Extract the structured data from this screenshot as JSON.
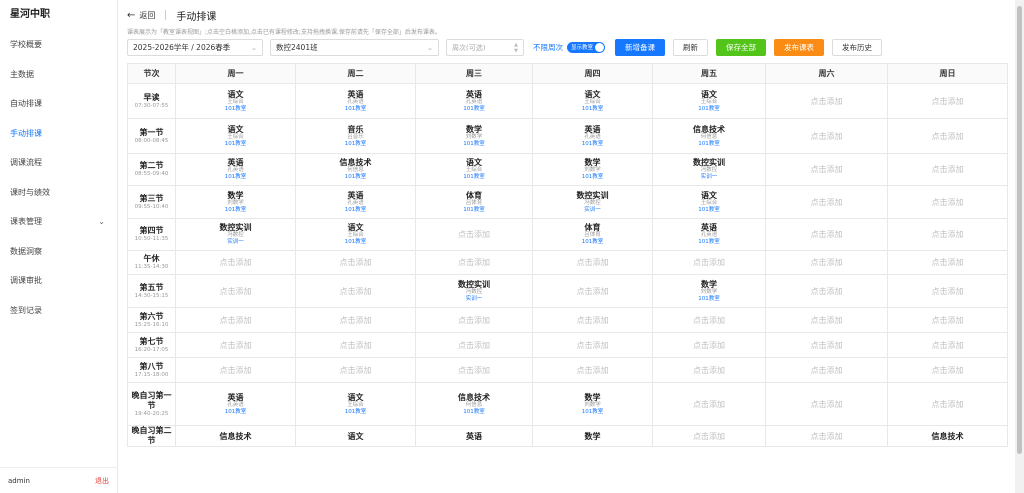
{
  "app": {
    "name": "星河中职"
  },
  "sidebar": {
    "items": [
      {
        "label": "学校概要",
        "active": false,
        "chevron": false
      },
      {
        "label": "主数据",
        "active": false,
        "chevron": false
      },
      {
        "label": "自动排课",
        "active": false,
        "chevron": false
      },
      {
        "label": "手动排课",
        "active": true,
        "chevron": false
      },
      {
        "label": "调课流程",
        "active": false,
        "chevron": false
      },
      {
        "label": "课时与绩效",
        "active": false,
        "chevron": false
      },
      {
        "label": "课表管理",
        "active": false,
        "chevron": true
      },
      {
        "label": "数据洞察",
        "active": false,
        "chevron": false
      },
      {
        "label": "调课审批",
        "active": false,
        "chevron": false
      },
      {
        "label": "签到记录",
        "active": false,
        "chevron": false
      }
    ],
    "user": "admin",
    "logout": "退出"
  },
  "header": {
    "back": "返回",
    "title": "手动排课",
    "hint": "课表展示为「教室课表视图」;点击空白格添加,点击已有课程修改;支持拖拽换课,保存前请先「保存全部」后发布课表。"
  },
  "filters": {
    "semester": "2025-2026学年 / 2026春季",
    "class": "数控2401班",
    "week_placeholder": "周次(可选)",
    "unlimited": "不限周次",
    "toggle": "显示教室"
  },
  "buttons": {
    "add_note": "新增备课",
    "refresh": "刷新",
    "save_all": "保存全部",
    "publish": "发布课表",
    "history": "发布历史"
  },
  "colors": {
    "primary": "#1677ff",
    "success": "#52c41a",
    "warning": "#fa8c16",
    "danger": "#e53935"
  },
  "empty_label": "点击添加",
  "timetable": {
    "columns": [
      "节次",
      "周一",
      "周二",
      "周三",
      "周四",
      "周五",
      "周六",
      "周日"
    ],
    "rows": [
      {
        "name": "早读",
        "time": "07:30-07:55",
        "cells": [
          {
            "subject": "语文",
            "teacher": "王综合",
            "room": "101教室"
          },
          {
            "subject": "英语",
            "teacher": "孔英语",
            "room": "101教室"
          },
          {
            "subject": "英语",
            "teacher": "孔英语",
            "room": "101教室"
          },
          {
            "subject": "语文",
            "teacher": "王综合",
            "room": "101教室"
          },
          {
            "subject": "语文",
            "teacher": "王综合",
            "room": "101教室"
          },
          null,
          null
        ]
      },
      {
        "name": "第一节",
        "time": "08:00-08:45",
        "cells": [
          {
            "subject": "语文",
            "teacher": "王综合",
            "room": "101教室"
          },
          {
            "subject": "音乐",
            "teacher": "吕音乐",
            "room": "101教室"
          },
          {
            "subject": "数学",
            "teacher": "刘数学",
            "room": "101教室"
          },
          {
            "subject": "英语",
            "teacher": "孔英语",
            "room": "101教室"
          },
          {
            "subject": "信息技术",
            "teacher": "何信息",
            "room": "101教室"
          },
          null,
          null
        ]
      },
      {
        "name": "第二节",
        "time": "08:55-09:40",
        "cells": [
          {
            "subject": "英语",
            "teacher": "孔英语",
            "room": "101教室"
          },
          {
            "subject": "信息技术",
            "teacher": "何信息",
            "room": "101教室"
          },
          {
            "subject": "语文",
            "teacher": "王综合",
            "room": "101教室"
          },
          {
            "subject": "数学",
            "teacher": "刘数学",
            "room": "101教室"
          },
          {
            "subject": "数控实训",
            "teacher": "冯数控",
            "room": "实训一"
          },
          null,
          null
        ]
      },
      {
        "name": "第三节",
        "time": "09:55-10:40",
        "cells": [
          {
            "subject": "数学",
            "teacher": "刘数学",
            "room": "101教室"
          },
          {
            "subject": "英语",
            "teacher": "孔英语",
            "room": "101教室"
          },
          {
            "subject": "体育",
            "teacher": "吕体育",
            "room": "101教室"
          },
          {
            "subject": "数控实训",
            "teacher": "冯数控",
            "room": "实训一"
          },
          {
            "subject": "语文",
            "teacher": "王综合",
            "room": "101教室"
          },
          null,
          null
        ]
      },
      {
        "name": "第四节",
        "time": "10:50-11:35",
        "cells": [
          {
            "subject": "数控实训",
            "teacher": "冯数控",
            "room": "实训一"
          },
          {
            "subject": "语文",
            "teacher": "王综合",
            "room": "101教室"
          },
          null,
          {
            "subject": "体育",
            "teacher": "吕体育",
            "room": "101教室"
          },
          {
            "subject": "英语",
            "teacher": "孔英语",
            "room": "101教室"
          },
          null,
          null
        ]
      },
      {
        "name": "午休",
        "time": "11:35-14:30",
        "cells": [
          null,
          null,
          null,
          null,
          null,
          null,
          null
        ]
      },
      {
        "name": "第五节",
        "time": "14:30-15:15",
        "cells": [
          null,
          null,
          {
            "subject": "数控实训",
            "teacher": "冯数控",
            "room": "实训一"
          },
          null,
          {
            "subject": "数学",
            "teacher": "刘数学",
            "room": "101教室"
          },
          null,
          null
        ]
      },
      {
        "name": "第六节",
        "time": "15:25-16:10",
        "cells": [
          null,
          null,
          null,
          null,
          null,
          null,
          null
        ]
      },
      {
        "name": "第七节",
        "time": "16:20-17:05",
        "cells": [
          null,
          null,
          null,
          null,
          null,
          null,
          null
        ]
      },
      {
        "name": "第八节",
        "time": "17:15-18:00",
        "cells": [
          null,
          null,
          null,
          null,
          null,
          null,
          null
        ]
      },
      {
        "name": "晚自习第一节",
        "time": "19:40-20:25",
        "cells": [
          {
            "subject": "英语",
            "teacher": "孔英语",
            "room": "101教室"
          },
          {
            "subject": "语文",
            "teacher": "王综合",
            "room": "101教室"
          },
          {
            "subject": "信息技术",
            "teacher": "何信息",
            "room": "101教室"
          },
          {
            "subject": "数学",
            "teacher": "刘数学",
            "room": "101教室"
          },
          null,
          null,
          null
        ]
      },
      {
        "name": "晚自习第二节",
        "time": "",
        "cells": [
          {
            "subject": "信息技术",
            "teacher": "",
            "room": ""
          },
          {
            "subject": "语文",
            "teacher": "",
            "room": ""
          },
          {
            "subject": "英语",
            "teacher": "",
            "room": ""
          },
          {
            "subject": "数学",
            "teacher": "",
            "room": ""
          },
          null,
          null,
          {
            "subject": "信息技术",
            "teacher": "",
            "room": ""
          }
        ]
      }
    ]
  }
}
